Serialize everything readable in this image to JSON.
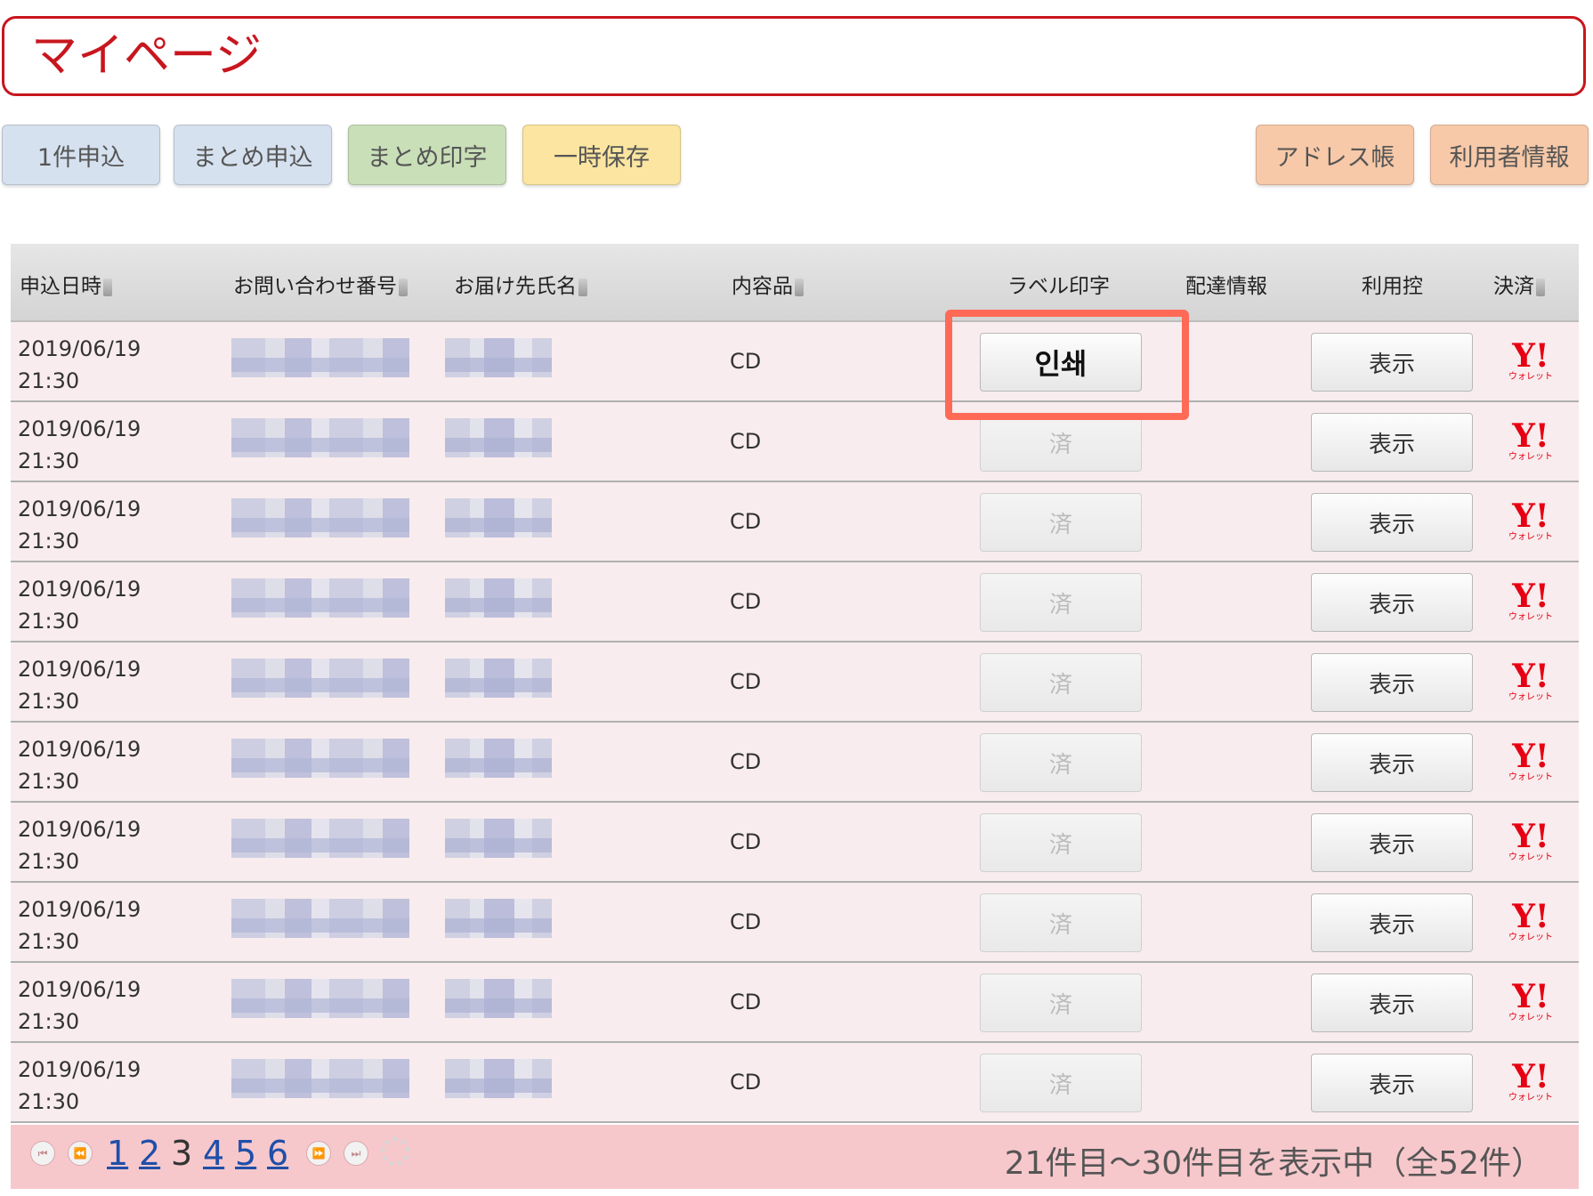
{
  "page": {
    "title": "マイページ"
  },
  "toolbar": {
    "single_apply": "1件申込",
    "bulk_apply": "まとめ申込",
    "bulk_print": "まとめ印字",
    "temp_save": "一時保存",
    "address_book": "アドレス帳",
    "user_info": "利用者情報"
  },
  "table": {
    "headers": {
      "date": "申込日時",
      "inquiry": "お問い合わせ番号",
      "recipient": "お届け先氏名",
      "content": "内容品",
      "label": "ラベル印字",
      "delivery": "配達情報",
      "receipt": "利用控",
      "payment": "決済"
    },
    "rows": [
      {
        "date": "2019/06/19",
        "time": "21:30",
        "content": "CD",
        "label": "인쇄",
        "view": "表示"
      },
      {
        "date": "2019/06/19",
        "time": "21:30",
        "content": "CD",
        "label": "済",
        "view": "表示"
      },
      {
        "date": "2019/06/19",
        "time": "21:30",
        "content": "CD",
        "label": "済",
        "view": "表示"
      },
      {
        "date": "2019/06/19",
        "time": "21:30",
        "content": "CD",
        "label": "済",
        "view": "表示"
      },
      {
        "date": "2019/06/19",
        "time": "21:30",
        "content": "CD",
        "label": "済",
        "view": "表示"
      },
      {
        "date": "2019/06/19",
        "time": "21:30",
        "content": "CD",
        "label": "済",
        "view": "表示"
      },
      {
        "date": "2019/06/19",
        "time": "21:30",
        "content": "CD",
        "label": "済",
        "view": "表示"
      },
      {
        "date": "2019/06/19",
        "time": "21:30",
        "content": "CD",
        "label": "済",
        "view": "表示"
      },
      {
        "date": "2019/06/19",
        "time": "21:30",
        "content": "CD",
        "label": "済",
        "view": "表示"
      },
      {
        "date": "2019/06/19",
        "time": "21:30",
        "content": "CD",
        "label": "済",
        "view": "表示"
      }
    ]
  },
  "payment_logo": {
    "main": "Y!",
    "sub": "ウォレット"
  },
  "pagination": {
    "pages": [
      "1",
      "2",
      "3",
      "4",
      "5",
      "6"
    ],
    "current": "3",
    "status": "21件目〜30件目を表示中（全52件）"
  },
  "icons": [
    "first-page-icon",
    "prev-page-icon",
    "next-page-icon",
    "last-page-icon",
    "loading-icon",
    "sort-icon"
  ],
  "colors": {
    "brand_red": "#c8161e",
    "highlight": "#ff6a57",
    "row_bg": "#f8ecee",
    "footer_bg": "#f6c8cc"
  }
}
